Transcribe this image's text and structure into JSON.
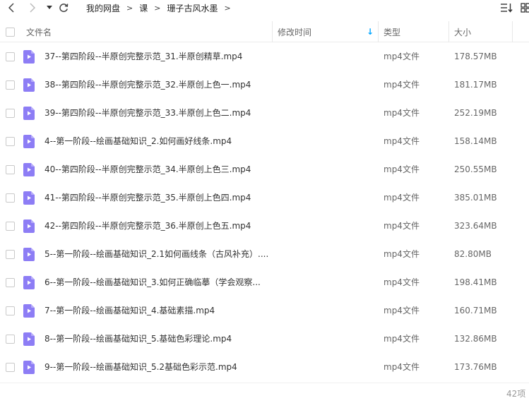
{
  "toolbar": {
    "back_icon": "chevron-left-icon",
    "forward_icon": "chevron-right-icon",
    "history_icon": "caret-down-icon",
    "refresh_icon": "refresh-icon",
    "breadcrumbs": [
      "我的网盘",
      "课",
      "珊子古风水墨"
    ],
    "separator": ">",
    "sort_icon": "sort-list-icon",
    "view_icon": "grid-view-icon"
  },
  "table": {
    "columns": {
      "name": "文件名",
      "modified": "修改时间",
      "type": "类型",
      "size": "大小"
    },
    "sort_indicator": "↓",
    "sort_color": "#06a7ff",
    "icon_color": "#8d7df5",
    "rows": [
      {
        "name": "37--第四阶段--半原创完整示范_31.半原创精草.mp4",
        "type": "mp4文件",
        "size": "178.57MB"
      },
      {
        "name": "38--第四阶段--半原创完整示范_32.半原创上色一.mp4",
        "type": "mp4文件",
        "size": "181.17MB"
      },
      {
        "name": "39--第四阶段--半原创完整示范_33.半原创上色二.mp4",
        "type": "mp4文件",
        "size": "252.19MB"
      },
      {
        "name": "4--第一阶段--绘画基础知识_2.如何画好线条.mp4",
        "type": "mp4文件",
        "size": "158.14MB"
      },
      {
        "name": "40--第四阶段--半原创完整示范_34.半原创上色三.mp4",
        "type": "mp4文件",
        "size": "250.55MB"
      },
      {
        "name": "41--第四阶段--半原创完整示范_35.半原创上色四.mp4",
        "type": "mp4文件",
        "size": "385.01MB"
      },
      {
        "name": "42--第四阶段--半原创完整示范_36.半原创上色五.mp4",
        "type": "mp4文件",
        "size": "323.64MB"
      },
      {
        "name": "5--第一阶段--绘画基础知识_2.1如何画线条（古风补充）....",
        "type": "mp4文件",
        "size": "82.80MB"
      },
      {
        "name": "6--第一阶段--绘画基础知识_3.如何正确临摹（学会观察...",
        "type": "mp4文件",
        "size": "198.41MB"
      },
      {
        "name": "7--第一阶段--绘画基础知识_4.基础素描.mp4",
        "type": "mp4文件",
        "size": "160.71MB"
      },
      {
        "name": "8--第一阶段--绘画基础知识_5.基础色彩理论.mp4",
        "type": "mp4文件",
        "size": "132.86MB"
      },
      {
        "name": "9--第一阶段--绘画基础知识_5.2基础色彩示范.mp4",
        "type": "mp4文件",
        "size": "173.76MB"
      }
    ]
  },
  "footer": {
    "item_count": "42项"
  }
}
